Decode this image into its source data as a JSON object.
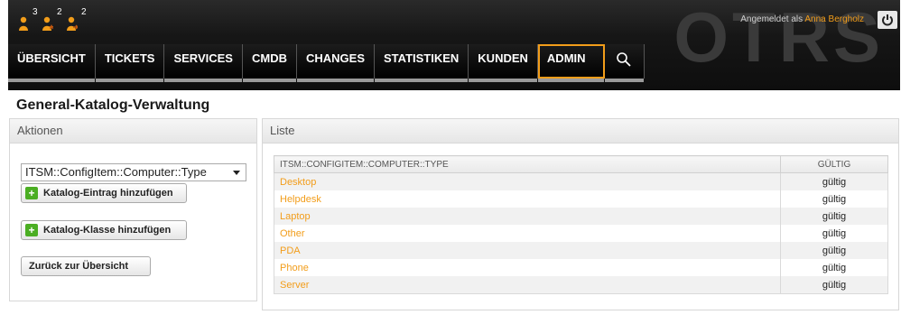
{
  "toolbar": {
    "icons": [
      {
        "icon": "user-icon",
        "count": "3"
      },
      {
        "icon": "user-star-icon",
        "count": "2"
      },
      {
        "icon": "user-arrow-icon",
        "count": "2"
      }
    ],
    "logged_in_prefix": "Angemeldet als",
    "user_name": "Anna Bergholz",
    "logo_text": "OTRS",
    "logout_icon": "power-icon"
  },
  "nav": {
    "items": [
      "ÜBERSICHT",
      "TICKETS",
      "SERVICES",
      "CMDB",
      "CHANGES",
      "STATISTIKEN",
      "KUNDEN",
      "ADMIN"
    ],
    "active": "ADMIN",
    "search_icon": "search-icon"
  },
  "page": {
    "title": "General-Katalog-Verwaltung"
  },
  "actions": {
    "header": "Aktionen",
    "select_value": "ITSM::ConfigItem::Computer::Type",
    "add_entry_label": "Katalog-Eintrag hinzufügen",
    "add_class_label": "Katalog-Klasse hinzufügen",
    "back_label": "Zurück zur Übersicht"
  },
  "list": {
    "header": "Liste",
    "columns": [
      "ITSM::CONFIGITEM::COMPUTER::TYPE",
      "GÜLTIG"
    ],
    "rows": [
      {
        "name": "Desktop",
        "valid": "gültig"
      },
      {
        "name": "Helpdesk",
        "valid": "gültig"
      },
      {
        "name": "Laptop",
        "valid": "gültig"
      },
      {
        "name": "Other",
        "valid": "gültig"
      },
      {
        "name": "PDA",
        "valid": "gültig"
      },
      {
        "name": "Phone",
        "valid": "gültig"
      },
      {
        "name": "Server",
        "valid": "gültig"
      }
    ]
  },
  "colors": {
    "accent": "#f29d1a",
    "add_icon": "#4bae23"
  }
}
